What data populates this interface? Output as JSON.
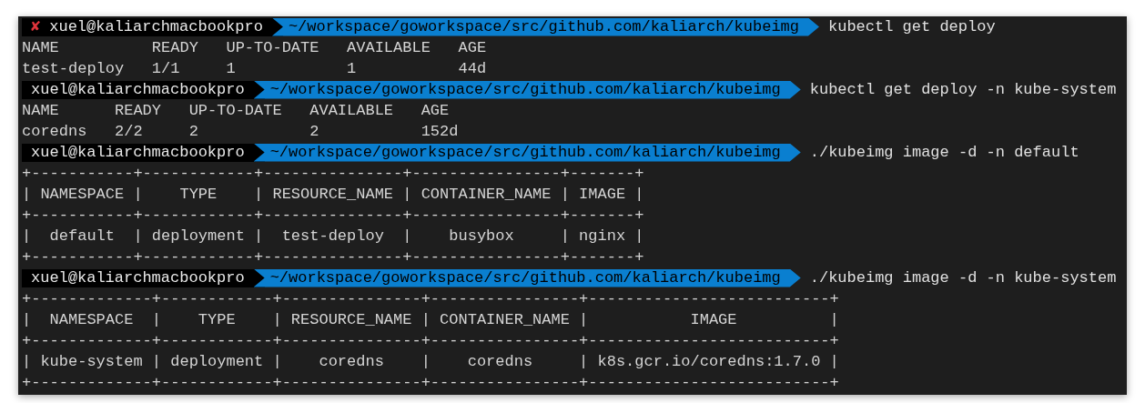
{
  "terminal": {
    "blocks": [
      {
        "prompt": {
          "error_mark": "✘",
          "user": "xuel@kaliarchmacbookpro",
          "path": "~/workspace/goworkspace/src/github.com/kaliarch/kubeimg",
          "command": "kubectl get deploy"
        },
        "output": [
          "NAME          READY   UP-TO-DATE   AVAILABLE   AGE",
          "test-deploy   1/1     1            1           44d"
        ]
      },
      {
        "prompt": {
          "user": "xuel@kaliarchmacbookpro",
          "path": "~/workspace/goworkspace/src/github.com/kaliarch/kubeimg",
          "command": "kubectl get deploy -n kube-system"
        },
        "output": [
          "NAME      READY   UP-TO-DATE   AVAILABLE   AGE",
          "coredns   2/2     2            2           152d"
        ]
      },
      {
        "prompt": {
          "user": "xuel@kaliarchmacbookpro",
          "path": "~/workspace/goworkspace/src/github.com/kaliarch/kubeimg",
          "command": "./kubeimg image -d -n default"
        },
        "output": [
          "+-----------+------------+---------------+----------------+-------+",
          "| NAMESPACE |    TYPE    | RESOURCE_NAME | CONTAINER_NAME | IMAGE |",
          "+-----------+------------+---------------+----------------+-------+",
          "|  default  | deployment |  test-deploy  |    busybox     | nginx |",
          "+-----------+------------+---------------+----------------+-------+"
        ]
      },
      {
        "prompt": {
          "user": "xuel@kaliarchmacbookpro",
          "path": "~/workspace/goworkspace/src/github.com/kaliarch/kubeimg",
          "command": "./kubeimg image -d -n kube-system"
        },
        "output": [
          "+-------------+------------+---------------+----------------+--------------------------+",
          "|  NAMESPACE  |    TYPE    | RESOURCE_NAME | CONTAINER_NAME |           IMAGE          |",
          "+-------------+------------+---------------+----------------+--------------------------+",
          "| kube-system | deployment |    coredns    |    coredns     | k8s.gcr.io/coredns:1.7.0 |",
          "+-------------+------------+---------------+----------------+--------------------------+"
        ]
      }
    ]
  }
}
